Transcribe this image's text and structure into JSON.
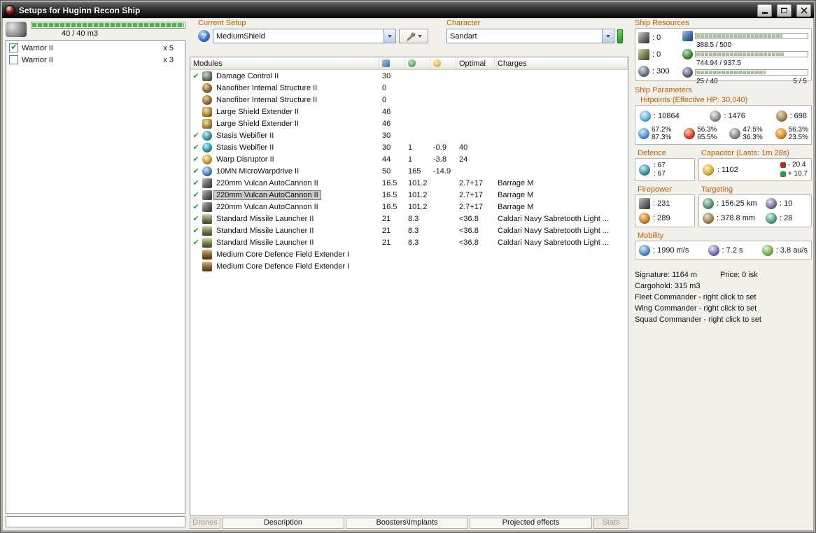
{
  "window": {
    "title": "Setups for Huginn Recon Ship"
  },
  "drone_bay": {
    "capacity": "40 / 40 m3",
    "fill_pct": 100,
    "items": [
      {
        "name": "Warrior II",
        "qty": "x 5",
        "checked": true
      },
      {
        "name": "Warrior II",
        "qty": "x 3",
        "checked": false
      }
    ]
  },
  "setup": {
    "label": "Current Setup",
    "value": "MediumShield"
  },
  "character": {
    "label": "Character",
    "value": "Sandart"
  },
  "modules_table": {
    "title": "Modules",
    "headers": {
      "optimal": "Optimal",
      "charges": "Charges"
    },
    "rows": [
      {
        "active": true,
        "selected": false,
        "icon": "damage-control",
        "name": "Damage Control II",
        "cpu": "30",
        "pg": "",
        "cap": "",
        "optimal": "",
        "charges": ""
      },
      {
        "active": false,
        "selected": false,
        "icon": "nanofiber",
        "name": "Nanofiber Internal Structure II",
        "cpu": "0",
        "pg": "",
        "cap": "",
        "optimal": "",
        "charges": ""
      },
      {
        "active": false,
        "selected": false,
        "icon": "nanofiber",
        "name": "Nanofiber Internal Structure II",
        "cpu": "0",
        "pg": "",
        "cap": "",
        "optimal": "",
        "charges": ""
      },
      {
        "active": false,
        "selected": false,
        "icon": "shield-extender",
        "name": "Large Shield Extender II",
        "cpu": "46",
        "pg": "",
        "cap": "",
        "optimal": "",
        "charges": ""
      },
      {
        "active": false,
        "selected": false,
        "icon": "shield-extender",
        "name": "Large Shield Extender II",
        "cpu": "46",
        "pg": "",
        "cap": "",
        "optimal": "",
        "charges": ""
      },
      {
        "active": true,
        "selected": false,
        "icon": "stasis-webifier",
        "name": "Stasis Webifier II",
        "cpu": "30",
        "pg": "",
        "cap": "",
        "optimal": "",
        "charges": ""
      },
      {
        "active": true,
        "selected": false,
        "icon": "stasis-webifier",
        "name": "Stasis Webifier II",
        "cpu": "30",
        "pg": "1",
        "cap": "-0.9",
        "optimal": "40",
        "charges": ""
      },
      {
        "active": true,
        "selected": false,
        "icon": "warp-disruptor",
        "name": "Warp Disruptor II",
        "cpu": "44",
        "pg": "1",
        "cap": "-3.8",
        "optimal": "24",
        "charges": ""
      },
      {
        "active": true,
        "selected": false,
        "icon": "mwd",
        "name": "10MN MicroWarpdrive II",
        "cpu": "50",
        "pg": "165",
        "cap": "-14.9",
        "optimal": "",
        "charges": ""
      },
      {
        "active": true,
        "selected": false,
        "icon": "autocannon",
        "name": "220mm Vulcan AutoCannon II",
        "cpu": "16.5",
        "pg": "101.2",
        "cap": "",
        "optimal": "2.7+17",
        "charges": "Barrage M"
      },
      {
        "active": true,
        "selected": true,
        "icon": "autocannon",
        "name": "220mm Vulcan AutoCannon II",
        "cpu": "16.5",
        "pg": "101.2",
        "cap": "",
        "optimal": "2.7+17",
        "charges": "Barrage M"
      },
      {
        "active": true,
        "selected": false,
        "icon": "autocannon",
        "name": "220mm Vulcan AutoCannon II",
        "cpu": "16.5",
        "pg": "101.2",
        "cap": "",
        "optimal": "2.7+17",
        "charges": "Barrage M"
      },
      {
        "active": true,
        "selected": false,
        "icon": "missile-launcher",
        "name": "Standard Missile Launcher II",
        "cpu": "21",
        "pg": "8.3",
        "cap": "",
        "optimal": "<36.8",
        "charges": "Caldari Navy Sabretooth Light ..."
      },
      {
        "active": true,
        "selected": false,
        "icon": "missile-launcher",
        "name": "Standard Missile Launcher II",
        "cpu": "21",
        "pg": "8.3",
        "cap": "",
        "optimal": "<36.8",
        "charges": "Caldari Navy Sabretooth Light ..."
      },
      {
        "active": true,
        "selected": false,
        "icon": "missile-launcher",
        "name": "Standard Missile Launcher II",
        "cpu": "21",
        "pg": "8.3",
        "cap": "",
        "optimal": "<36.8",
        "charges": "Caldari Navy Sabretooth Light ..."
      },
      {
        "active": false,
        "selected": false,
        "icon": "rig",
        "name": "Medium Core Defence Field Extender I",
        "cpu": "",
        "pg": "",
        "cap": "",
        "optimal": "",
        "charges": ""
      },
      {
        "active": false,
        "selected": false,
        "icon": "rig",
        "name": "Medium Core Defence Field Extender I",
        "cpu": "",
        "pg": "",
        "cap": "",
        "optimal": "",
        "charges": ""
      }
    ]
  },
  "bottom_tabs": [
    {
      "label": "Drones",
      "state": "disabled"
    },
    {
      "label": "Description",
      "state": "normal"
    },
    {
      "label": "Boosters\\Implants",
      "state": "normal"
    },
    {
      "label": "Projected effects",
      "state": "normal"
    },
    {
      "label": "Stats",
      "state": "disabled"
    }
  ],
  "ship_resources": {
    "title": "Ship Resources",
    "slots": [
      {
        "icon": "turret-hardpoints",
        "value": ": 0"
      },
      {
        "icon": "launcher-hardpoints",
        "value": ": 0"
      },
      {
        "icon": "calibration",
        "value": ": 300"
      }
    ],
    "gauges": [
      {
        "icon": "cpu",
        "text": "388.5 / 500",
        "pct": 77.7,
        "extra": ""
      },
      {
        "icon": "powergrid",
        "text": "744.94 / 937.5",
        "pct": 79.5,
        "extra": ""
      },
      {
        "icon": "drone-bandwidth",
        "text": "25 / 40",
        "pct": 62.5,
        "extra": "5 / 5"
      }
    ]
  },
  "ship_parameters": {
    "title": "Ship Parameters",
    "hitpoints": {
      "label": "Hitpoints (Effective HP: 30,040)",
      "pools": [
        {
          "icon": "shield",
          "value": ": 10864"
        },
        {
          "icon": "armor",
          "value": ": 1476"
        },
        {
          "icon": "structure",
          "value": ": 698"
        }
      ],
      "resists": [
        {
          "icon": "em-resist",
          "shield": "67.2%",
          "armor": "87.3%"
        },
        {
          "icon": "thermal-resist",
          "shield": "56.3%",
          "armor": "65.5%"
        },
        {
          "icon": "kinetic-resist",
          "shield": "47.5%",
          "armor": "36.3%"
        },
        {
          "icon": "explosive-resist",
          "shield": "56.3%",
          "armor": "23.5%"
        }
      ]
    },
    "defence": {
      "title": "Defence",
      "top": ": 67",
      "bottom": ": 67"
    },
    "capacitor": {
      "title": "Capacitor (Lasts: 1m 28s)",
      "amount": ": 1102",
      "drain": "- 20.4",
      "recharge": "+ 10.7"
    },
    "firepower": {
      "title": "Firepower",
      "values": [
        {
          "icon": "turret-dps",
          "value": ": 231"
        },
        {
          "icon": "volley-damage",
          "value": ": 289"
        }
      ]
    },
    "targeting": {
      "title": "Targeting",
      "values": [
        {
          "icon": "targeting-range",
          "value": ": 156.25 km"
        },
        {
          "icon": "max-targets",
          "value": ": 10"
        },
        {
          "icon": "scan-resolution",
          "value": ": 378.8 mm"
        },
        {
          "icon": "sensor-strength",
          "value": ": 28"
        }
      ]
    },
    "mobility": {
      "title": "Mobility",
      "values": [
        {
          "icon": "max-velocity",
          "value": ": 1990 m/s"
        },
        {
          "icon": "align-time",
          "value": ": 7.2 s"
        },
        {
          "icon": "warp-speed",
          "value": ": 3.8 au/s"
        }
      ]
    },
    "info": {
      "signature": "Signature: 1164 m",
      "price": "Price: 0 isk",
      "cargohold": "Cargohold: 315 m3",
      "fleet": "Fleet Commander - right click to set",
      "wing": "Wing Commander - right click to set",
      "squad": "Squad Commander - right click to set"
    }
  }
}
